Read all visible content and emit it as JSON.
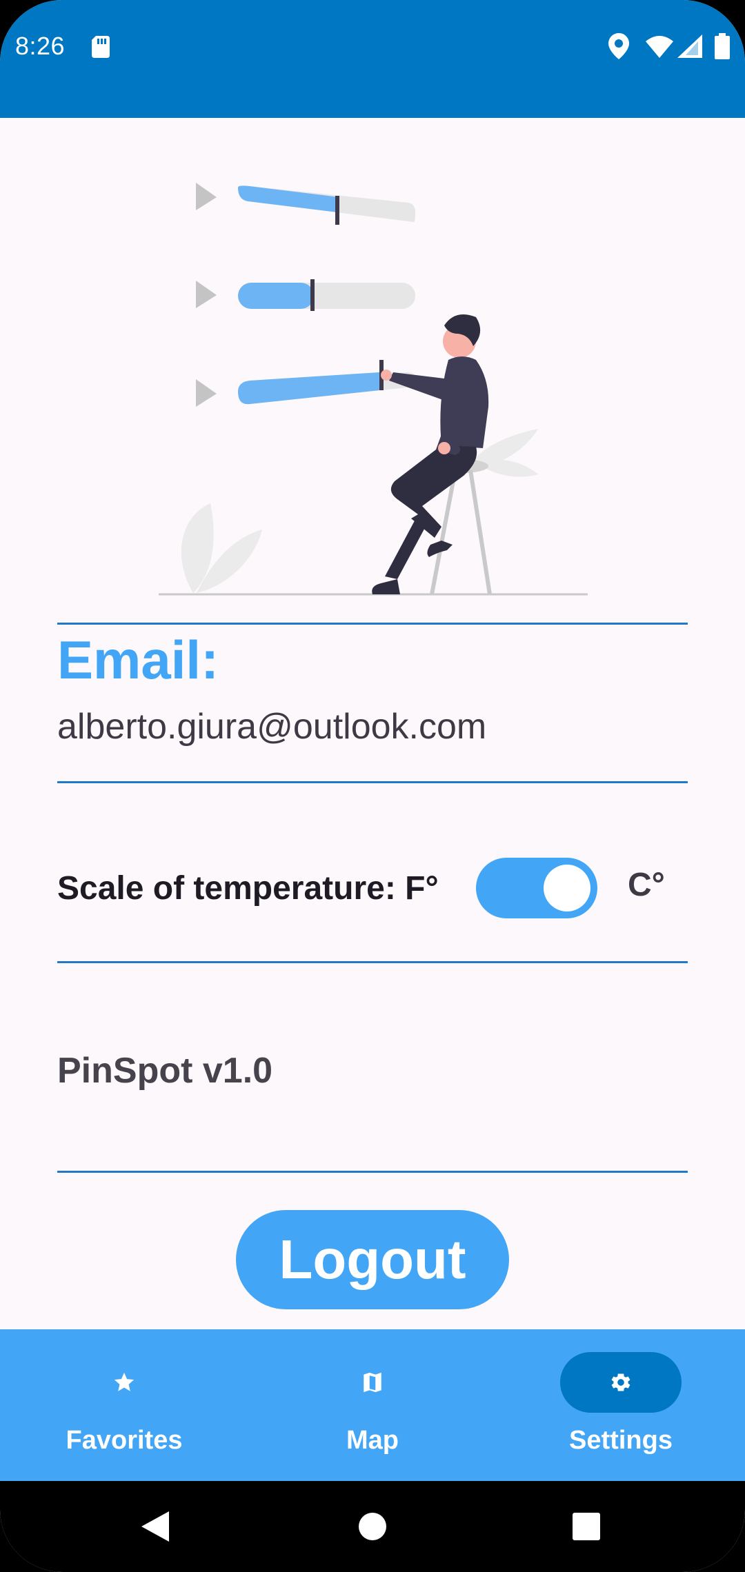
{
  "status_bar": {
    "time": "8:26",
    "icons": [
      "sd-card-icon",
      "location-icon",
      "wifi-icon",
      "cell-signal-icon",
      "battery-icon"
    ]
  },
  "illustration": {
    "description_icon": "person-adjusting-sliders-illustration",
    "slider_levels": [
      0.55,
      0.42,
      0.82
    ]
  },
  "account": {
    "email_label": "Email:",
    "email_value": "alberto.giura@outlook.com"
  },
  "temperature": {
    "label": "Scale of temperature: F°",
    "alt_label": "C°",
    "toggle_on": true
  },
  "app": {
    "version": "PinSpot v1.0"
  },
  "logout_label": "Logout",
  "bottom_nav": {
    "items": [
      {
        "label": "Favorites",
        "icon": "star-icon",
        "active": false
      },
      {
        "label": "Map",
        "icon": "map-icon",
        "active": false
      },
      {
        "label": "Settings",
        "icon": "gear-icon",
        "active": true
      }
    ]
  },
  "colors": {
    "primary_dark": "#0077C2",
    "primary": "#42A5F5",
    "background": "#FCF8FB",
    "divider": "#1F78C8"
  }
}
